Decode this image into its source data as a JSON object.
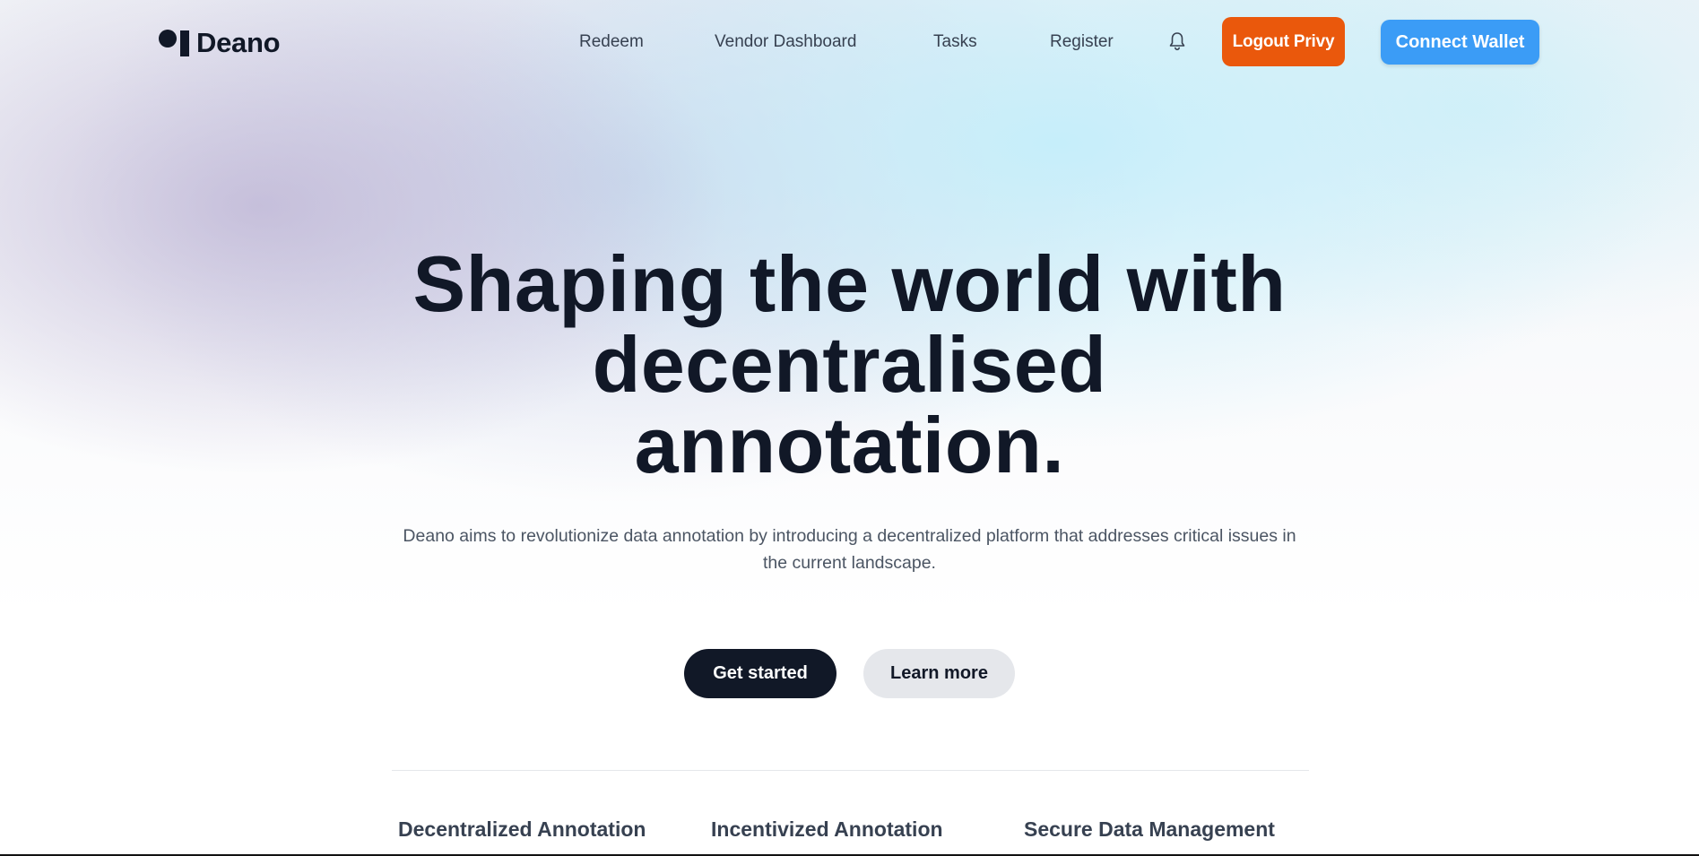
{
  "brand": {
    "name": "Deano",
    "logo_icon": "dot-bar-logo-icon"
  },
  "nav": {
    "items": [
      {
        "label": "Redeem"
      },
      {
        "label": "Vendor Dashboard"
      },
      {
        "label": "Tasks"
      },
      {
        "label": "Register"
      }
    ],
    "notification_icon": "bell-icon"
  },
  "header_actions": {
    "logout_label": "Logout Privy",
    "connect_label": "Connect Wallet"
  },
  "hero": {
    "title_lines": [
      "Shaping the world with",
      "decentralised",
      "annotation."
    ],
    "subtitle": "Deano aims to revolutionize data annotation by introducing a decentralized platform that addresses critical issues in the current landscape.",
    "primary_cta": "Get started",
    "secondary_cta": "Learn more"
  },
  "features": [
    {
      "title": "Decentralized Annotation"
    },
    {
      "title": "Incentivized Annotation"
    },
    {
      "title": "Secure Data Management"
    }
  ],
  "colors": {
    "logout_button": "#ea580c",
    "connect_button": "#3b9cf6",
    "primary_cta": "#111827",
    "secondary_cta": "#e5e7eb",
    "text_dark": "#111827"
  }
}
